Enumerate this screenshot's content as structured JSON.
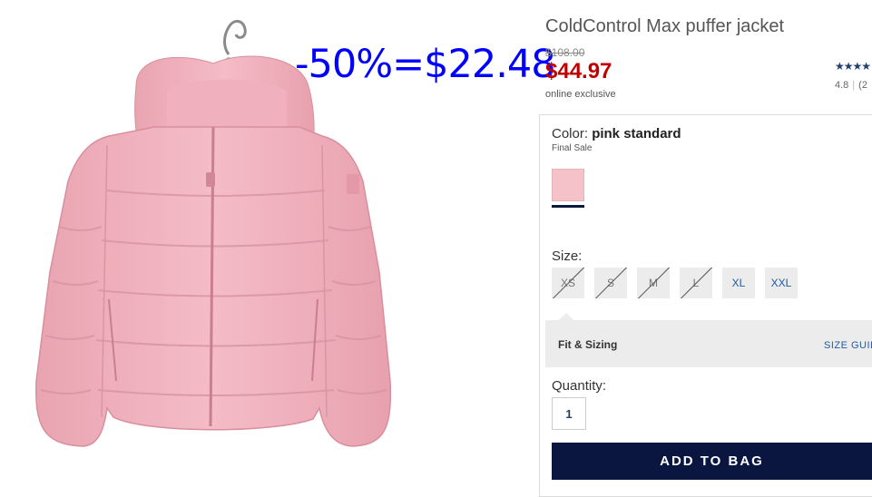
{
  "product": {
    "title": "ColdControl Max puffer jacket",
    "old_price": "$108.00",
    "sale_price": "$44.97",
    "online_exclusive": "online exclusive",
    "promo_overlay": "-50%=$22.48",
    "rating_stars": "★★★★",
    "rating_value": "4.8",
    "rating_count": "(2"
  },
  "color": {
    "label": "Color:",
    "value": "pink standard",
    "note": "Final Sale",
    "swatch_hex": "#f6c2ca"
  },
  "size": {
    "label": "Size:",
    "options": [
      {
        "label": "XS",
        "available": false
      },
      {
        "label": "S",
        "available": false
      },
      {
        "label": "M",
        "available": false
      },
      {
        "label": "L",
        "available": false
      },
      {
        "label": "XL",
        "available": true
      },
      {
        "label": "XXL",
        "available": true
      }
    ]
  },
  "fit": {
    "label": "Fit & Sizing",
    "size_guide": "SIZE GUID"
  },
  "quantity": {
    "label": "Quantity:",
    "value": "1"
  },
  "cart": {
    "add_label": "ADD TO BAG"
  },
  "colors": {
    "brand_navy": "#0a1540",
    "sale_red": "#c00000",
    "promo_blue": "#0000ff",
    "jacket_pink": "#f2b6c1"
  }
}
